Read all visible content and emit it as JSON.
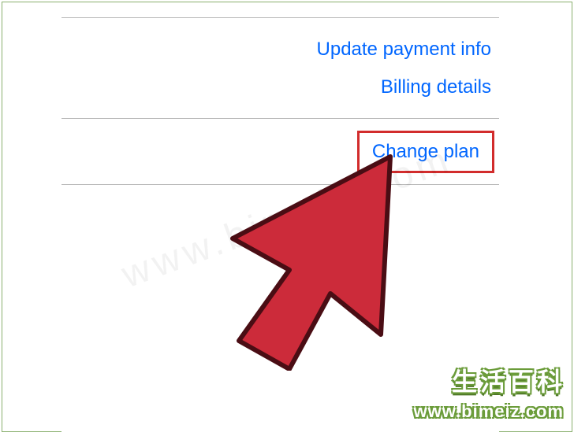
{
  "links": {
    "update_payment": "Update payment info",
    "billing_details": "Billing details",
    "change_plan": "Change plan"
  },
  "watermark": {
    "logo_text": "生活百科",
    "url_text": "www.bimeiz.com",
    "diag_text": "www.bimeiz.com"
  }
}
